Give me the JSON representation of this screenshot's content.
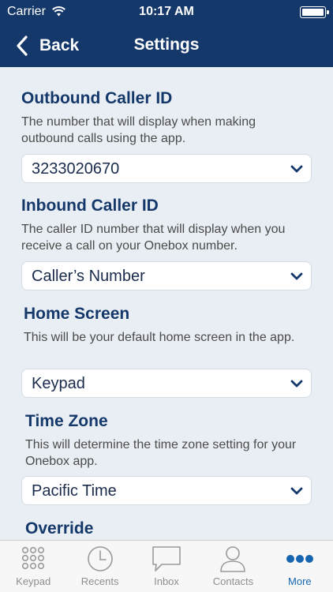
{
  "status_bar": {
    "carrier": "Carrier",
    "time": "10:17 AM"
  },
  "nav": {
    "back_label": "Back",
    "title": "Settings"
  },
  "settings": {
    "outbound": {
      "title": "Outbound Caller ID",
      "description": "The number that will display when making outbound calls using the app.",
      "value": "3233020670"
    },
    "inbound": {
      "title": "Inbound Caller ID",
      "description": "The caller ID number that will display when you receive a call on your Onebox number.",
      "value": "Caller’s Number"
    },
    "home_screen": {
      "title": "Home Screen",
      "description": "This will be your default home screen in the app.",
      "value": "Keypad"
    },
    "time_zone": {
      "title": "Time Zone",
      "description": "This will determine the time zone setting for your Onebox app.",
      "value": "Pacific Time"
    },
    "override": {
      "title": "Override"
    }
  },
  "tabs": [
    {
      "label": "Keypad",
      "icon": "keypad-icon",
      "active": false
    },
    {
      "label": "Recents",
      "icon": "clock-icon",
      "active": false
    },
    {
      "label": "Inbox",
      "icon": "speech-bubble-icon",
      "active": false
    },
    {
      "label": "Contacts",
      "icon": "person-icon",
      "active": false
    },
    {
      "label": "More",
      "icon": "more-dots-icon",
      "active": true
    }
  ],
  "colors": {
    "nav_background": "#15386b",
    "section_title": "#15386b",
    "page_background": "#e8eef3",
    "active_tab": "#1565b0",
    "inactive_tab": "#8e8e8e"
  }
}
